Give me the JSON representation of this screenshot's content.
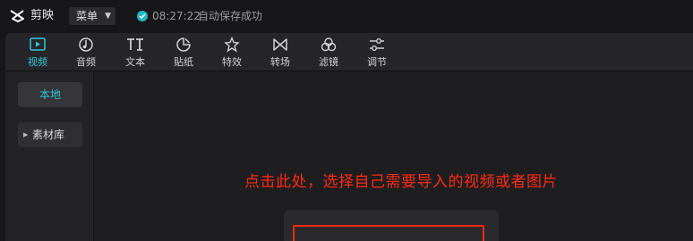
{
  "app": {
    "name": "剪映",
    "menu_label": "菜单"
  },
  "status": {
    "time": "08:27:22",
    "message": "自动保存成功"
  },
  "toolbar": {
    "tabs": [
      {
        "label": "视频",
        "icon": "video-icon",
        "active": true
      },
      {
        "label": "音频",
        "icon": "audio-icon",
        "active": false
      },
      {
        "label": "文本",
        "icon": "text-icon",
        "active": false
      },
      {
        "label": "贴纸",
        "icon": "sticker-icon",
        "active": false
      },
      {
        "label": "特效",
        "icon": "effects-icon",
        "active": false
      },
      {
        "label": "转场",
        "icon": "transition-icon",
        "active": false
      },
      {
        "label": "滤镜",
        "icon": "filter-icon",
        "active": false
      },
      {
        "label": "调节",
        "icon": "adjust-icon",
        "active": false
      }
    ]
  },
  "sidebar": {
    "local_label": "本地",
    "library_label": "素材库"
  },
  "content": {
    "hint": "点击此处，选择自己需要导入的视频或者图片"
  },
  "colors": {
    "accent": "#2ec7d6",
    "annotation": "#ff2a12",
    "background": "#17171a"
  }
}
